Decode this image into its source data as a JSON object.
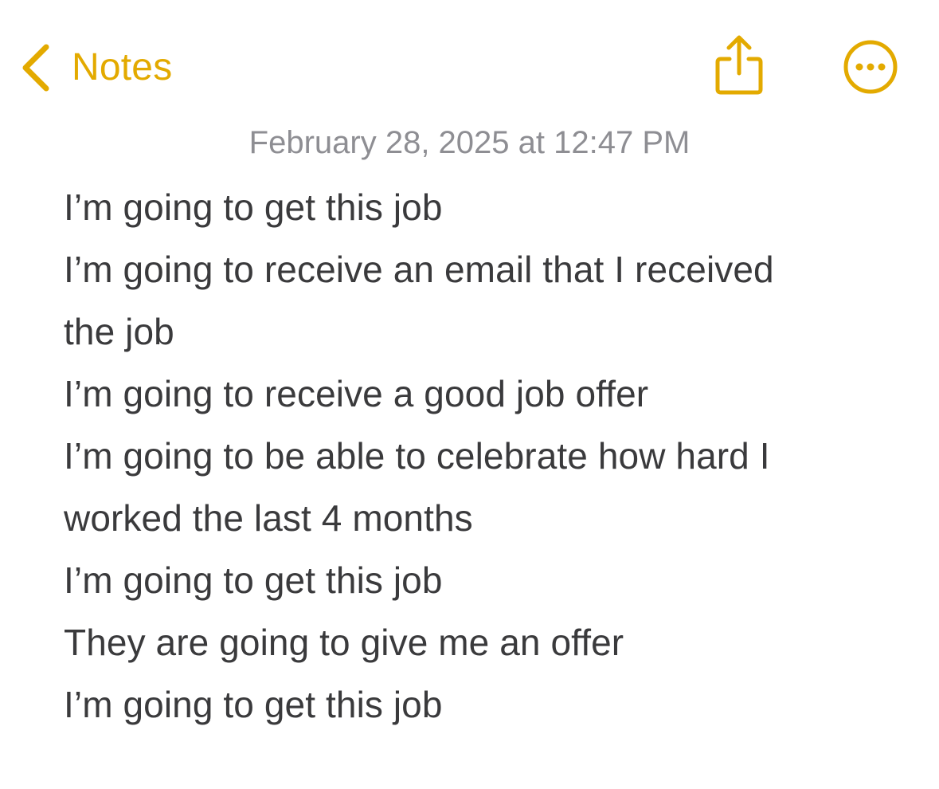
{
  "app": {
    "accent_color": "#E3AA00",
    "text_color": "#3A3A3C",
    "secondary_text_color": "#8E8E93",
    "background_color": "#FFFFFF"
  },
  "nav": {
    "back_icon": "chevron-left-icon",
    "back_label": "Notes",
    "share_icon": "share-icon",
    "more_icon": "ellipsis-circle-icon"
  },
  "note": {
    "date": "February 28, 2025 at 12:47 PM",
    "lines": [
      "I’m going to get this job",
      "I’m going to receive an email that I received",
      "the job",
      "I’m going to receive a good job offer",
      "I’m going to be able to celebrate how hard I",
      "worked the last 4 months",
      "I’m going to get this job",
      "They are going to give me an offer",
      "I’m going to get this job"
    ]
  }
}
